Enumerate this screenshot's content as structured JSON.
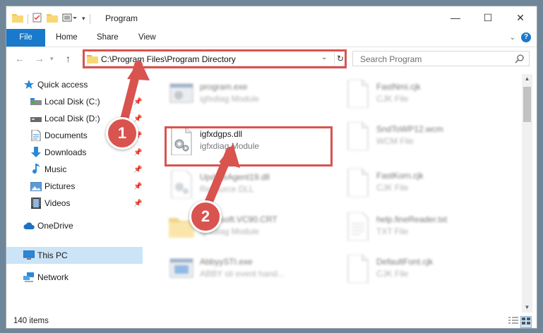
{
  "window": {
    "title": "Program",
    "controls": {
      "minimize": "—",
      "maximize": "☐",
      "close": "✕"
    }
  },
  "ribbon": {
    "tabs": [
      "File",
      "Home",
      "Share",
      "View"
    ]
  },
  "nav": {
    "address": "C:\\Program Files\\Program Directory",
    "search_placeholder": "Search Program"
  },
  "sidebar": {
    "items": [
      {
        "label": "Quick access",
        "icon": "star-icon"
      },
      {
        "label": "Local Disk (C:)",
        "icon": "drive-icon",
        "pinned": true
      },
      {
        "label": "Local Disk (D:)",
        "icon": "drive-icon",
        "pinned": true
      },
      {
        "label": "Documents",
        "icon": "documents-icon",
        "pinned": true
      },
      {
        "label": "Downloads",
        "icon": "download-icon",
        "pinned": true
      },
      {
        "label": "Music",
        "icon": "music-icon",
        "pinned": true
      },
      {
        "label": "Pictures",
        "icon": "pictures-icon",
        "pinned": true
      },
      {
        "label": "Videos",
        "icon": "video-icon",
        "pinned": true
      },
      {
        "label": "OneDrive",
        "icon": "cloud-icon"
      },
      {
        "label": "This PC",
        "icon": "computer-icon",
        "selected": true
      },
      {
        "label": "Network",
        "icon": "network-icon"
      }
    ]
  },
  "files": {
    "left_column": [
      {
        "name": "program.exe",
        "type": "igfxdiag Module",
        "blurred": true
      },
      {
        "name": "igfxdgps.dll",
        "type": "igfxdiag Module",
        "blurred": false,
        "highlighted": true
      },
      {
        "name": "UpdateAgent19.dll",
        "type": "Resource DLL",
        "blurred": true
      },
      {
        "name": "Microsoft.VC90.CRT",
        "type": "igfxdiag Module",
        "blurred": true
      },
      {
        "name": "AbbyySTI.exe",
        "type": "ABBY sti event hand...",
        "blurred": true
      }
    ],
    "right_column": [
      {
        "name": "FastNmi.cjk",
        "type": "CJK File"
      },
      {
        "name": "SndToWP12.wcm",
        "type": "WCM File"
      },
      {
        "name": "FastKorn.cjk",
        "type": "CJK File"
      },
      {
        "name": "help.fineReader.txt",
        "type": "TXT File"
      },
      {
        "name": "DefaultFont.cjk",
        "type": "CJK File"
      }
    ]
  },
  "status": {
    "item_count": "140 items"
  },
  "annotations": {
    "step1": "1",
    "step2": "2",
    "color": "#d9534f"
  }
}
